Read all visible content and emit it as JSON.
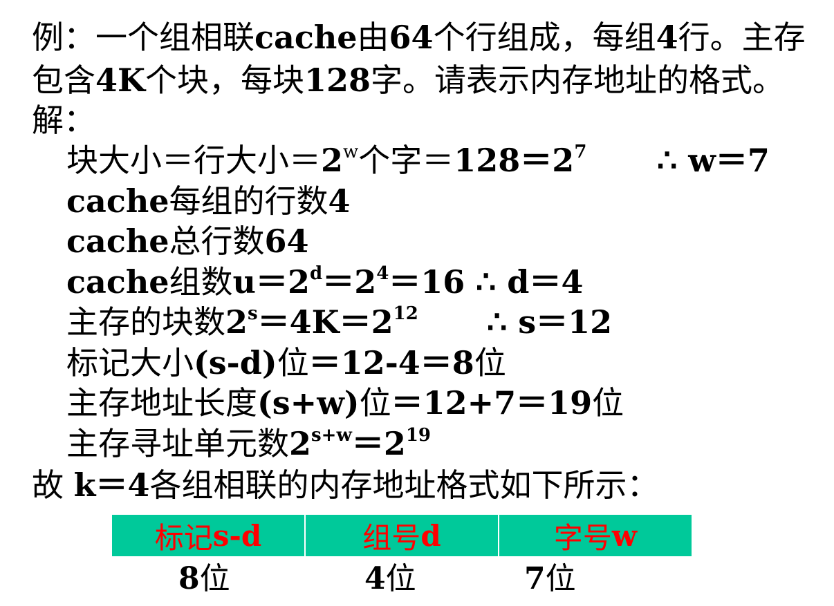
{
  "problem": {
    "line1": {
      "p1": "例：一个组相联",
      "p2": "cache",
      "p3": "由",
      "p4": "64",
      "p5": "个行组成，每组",
      "p6": "4",
      "p7": "行。主存"
    },
    "line2": {
      "p1": "包含",
      "p2": "4K",
      "p3": "个块，每块",
      "p4": "128",
      "p5": "字。请表示内存地址的格式。"
    }
  },
  "solution": {
    "label": "解：",
    "block_size": {
      "p1": "块大小＝行大小＝",
      "p2": "2",
      "sup1": "w",
      "p3": "个字＝",
      "p4": "128＝2",
      "sup2": "7",
      "result": "∴ w＝7"
    },
    "lines_per_set": {
      "p1": "cache",
      "p2": "每组的行数",
      "p3": "4"
    },
    "total_lines": {
      "p1": "cache",
      "p2": "总行数",
      "p3": "64"
    },
    "set_count": {
      "p1": "cache",
      "p2": "组数",
      "p3": "u＝2",
      "sup1": "d",
      "p4": "＝2",
      "sup2": "4",
      "p5": "＝16",
      "result": "∴ d＝4"
    },
    "main_blocks": {
      "p1": "主存的块数",
      "p2": "2",
      "sup1": "s",
      "p3": "＝4K＝2",
      "sup2": "12",
      "result": "∴ s＝12"
    },
    "tag_size": {
      "p1": "标记大小",
      "p2": "(s-d)",
      "p3": "位",
      "p4": "＝12-4＝8",
      "p5": "位"
    },
    "addr_length": {
      "p1": "主存地址长度",
      "p2": "(s+w)",
      "p3": "位",
      "p4": "＝12+7＝19",
      "p5": "位"
    },
    "addr_units": {
      "p1": "主存寻址单元数",
      "p2": "2",
      "sup1": "s+w",
      "p3": "＝2",
      "sup2": "19"
    },
    "conclusion": {
      "p1": "故 ",
      "p2": "k＝4",
      "p3": "各组相联的内存地址格式如下所示："
    }
  },
  "address_format": {
    "fields": [
      {
        "p1": "标记",
        "p2": "s-d"
      },
      {
        "p1": "组号",
        "p2": "d"
      },
      {
        "p1": "字号",
        "p2": "w"
      }
    ],
    "bits": [
      {
        "num": "8",
        "unit": "位"
      },
      {
        "num": "4",
        "unit": "位"
      },
      {
        "num": "7",
        "unit": "位"
      }
    ]
  },
  "colors": {
    "header_bg": "#00c99a",
    "header_text": "#ff0000"
  }
}
